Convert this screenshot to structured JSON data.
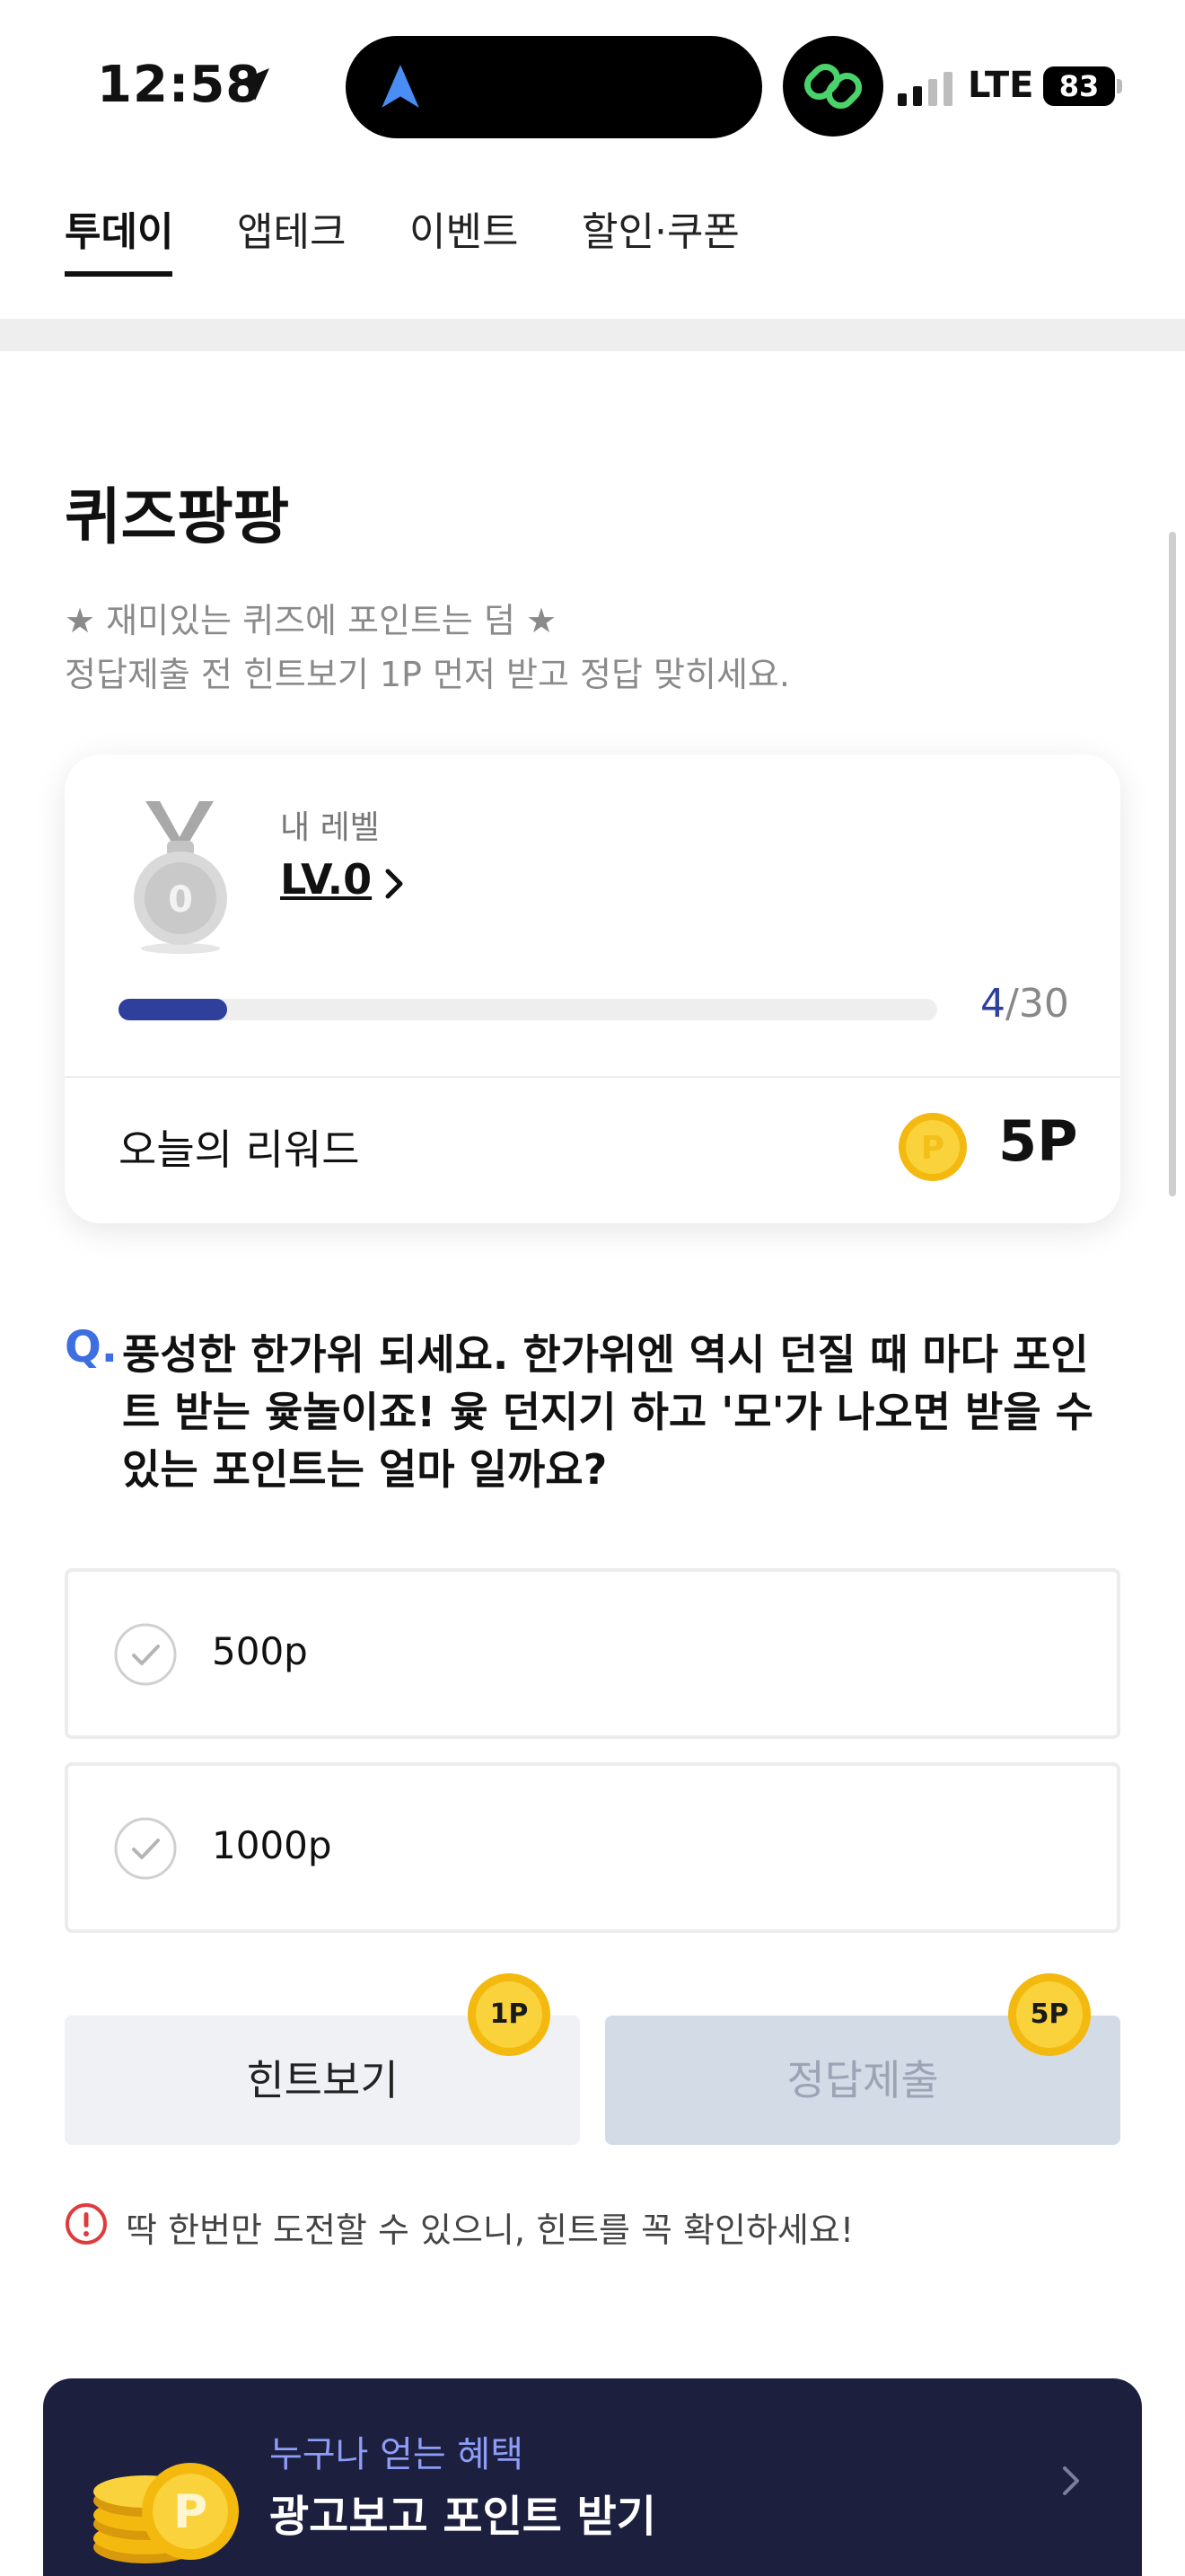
{
  "status_bar": {
    "time": "12:58",
    "network": "LTE",
    "battery": "83"
  },
  "tabs": [
    {
      "label": "투데이",
      "active": true
    },
    {
      "label": "앱테크",
      "active": false
    },
    {
      "label": "이벤트",
      "active": false
    },
    {
      "label": "할인·쿠폰",
      "active": false
    }
  ],
  "quiz": {
    "title": "퀴즈팡팡",
    "description_line1": "★ 재미있는 퀴즈에 포인트는 덤 ★",
    "description_line2": "정답제출 전 힌트보기 1P 먼저 받고 정답 맞히세요."
  },
  "level_card": {
    "medal_number": "0",
    "level_label": "내 레벨",
    "level_value": "LV.0",
    "progress_current": "4",
    "progress_total": "/30",
    "progress_fraction": 0.133,
    "reward_label": "오늘의 리워드",
    "coin_letter": "P",
    "reward_value": "5P"
  },
  "question": {
    "marker": "Q.",
    "lines": [
      "풍성한 한가위 되세요. 한가위엔 역시 던질 때 마다 포인",
      "트 받는 윷놀이죠! 윷 던지기 하고 '모'가 나오면 받을 수",
      "있는 포인트는 얼마 일까요?"
    ]
  },
  "options": [
    {
      "label": "500p"
    },
    {
      "label": "1000p"
    }
  ],
  "buttons": {
    "hint_label": "힌트보기",
    "hint_badge": "1P",
    "submit_label": "정답제출",
    "submit_badge": "5P"
  },
  "warning": "딱 한번만 도전할 수 있으니, 힌트를 꼭 확인하세요!",
  "ad_banner": {
    "subtitle": "누구나 얻는 혜택",
    "title": "광고보고 포인트 받기",
    "coin_letter": "P"
  },
  "colors": {
    "accent_blue": "#2e3f9c",
    "question_blue": "#3d6fe0",
    "coin_gold": "#f6c21c",
    "banner_navy": "#1c1f3e",
    "warning_red": "#e03b3b"
  }
}
